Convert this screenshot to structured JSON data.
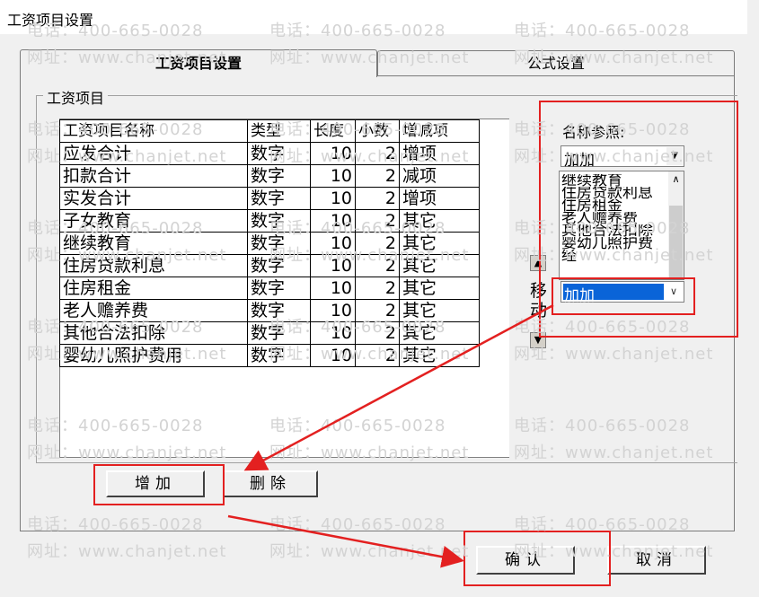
{
  "window": {
    "title": "工资项目设置"
  },
  "watermark": {
    "phone": "电话：400-665-0028",
    "site": "网址：www.chanjet.net"
  },
  "tabs": [
    {
      "label": "工资项目设置"
    },
    {
      "label": "公式设置"
    }
  ],
  "group": {
    "label": "工资项目"
  },
  "table": {
    "headers": [
      "工资项目名称",
      "类型",
      "长度",
      "小数",
      "增减项"
    ],
    "rows": [
      [
        "应发合计",
        "数字",
        "10",
        "2",
        "增项"
      ],
      [
        "扣款合计",
        "数字",
        "10",
        "2",
        "减项"
      ],
      [
        "实发合计",
        "数字",
        "10",
        "2",
        "增项"
      ],
      [
        "子女教育",
        "数字",
        "10",
        "2",
        "其它"
      ],
      [
        "继续教育",
        "数字",
        "10",
        "2",
        "其它"
      ],
      [
        "住房贷款利息",
        "数字",
        "10",
        "2",
        "其它"
      ],
      [
        "住房租金",
        "数字",
        "10",
        "2",
        "其它"
      ],
      [
        "老人赡养费",
        "数字",
        "10",
        "2",
        "其它"
      ],
      [
        "其他合法扣除",
        "数字",
        "10",
        "2",
        "其它"
      ],
      [
        "婴幼儿照护费用",
        "数字",
        "10",
        "2",
        "其它"
      ]
    ]
  },
  "move": {
    "label": "移动"
  },
  "reference": {
    "label": "名称参照:",
    "selected": "加加",
    "list": [
      "继续教育",
      "住房贷款利息",
      "住房租金",
      "老人赡养费",
      "其他合法扣除",
      "婴幼儿照护费",
      "经"
    ],
    "edit_value": "加加"
  },
  "buttons": {
    "add": "增加",
    "delete": "删除",
    "ok": "确认",
    "cancel": "取消"
  },
  "colors": {
    "highlight": "#e32020",
    "selection": "#0a64d8"
  }
}
